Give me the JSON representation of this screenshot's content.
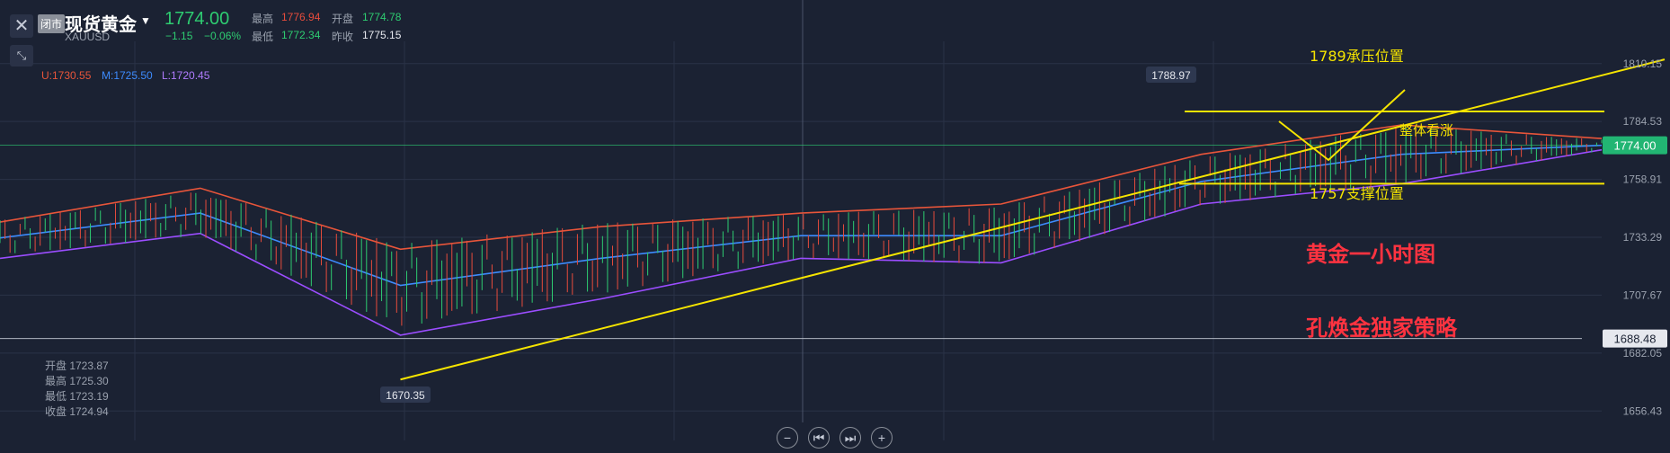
{
  "header": {
    "badge": "闭市",
    "symbol": "现货黄金",
    "code": "XAUUSD",
    "price": "1774.00",
    "change": "−1.15",
    "change_pct": "−0.06%",
    "high_label": "最高",
    "high": "1776.94",
    "open_label": "开盘",
    "open": "1774.78",
    "low_label": "最低",
    "low": "1772.34",
    "prev_label": "昨收",
    "prev_close": "1775.15"
  },
  "indicators": {
    "upper": "U:1730.55",
    "middle": "M:1725.50",
    "lower": "L:1720.45"
  },
  "ohlc_box": [
    "开盘 1723.87",
    "最高 1725.30",
    "最低 1723.19",
    "收盘 1724.94"
  ],
  "annotations": {
    "resistance": "1789承压位置",
    "support": "1757支撑位置",
    "bullish": "整体看涨",
    "title": "黄金一小时图",
    "author": "孔焕金独家策略",
    "peak": "1788.97",
    "trough": "1670.35"
  },
  "price_axis": [
    "1810.15",
    "1784.53",
    "1758.91",
    "1733.29",
    "1707.67",
    "1682.05",
    "1656.43"
  ],
  "current_price_tag": "1774.00",
  "alert_price_tag": "1688.48",
  "colors": {
    "up": "#2ecc71",
    "down": "#e74c3c",
    "upper_band": "#e8553a",
    "middle_band": "#3d8bfd",
    "lower_band": "#9b4dff",
    "trend": "#f5e400"
  },
  "chart_data": {
    "type": "line",
    "title": "黄金一小时图",
    "ylim": [
      1645,
      1820
    ],
    "x": [
      0,
      20,
      40,
      60,
      80,
      100,
      120,
      140,
      160
    ],
    "series": [
      {
        "name": "U",
        "values": [
          1740,
          1755,
          1728,
          1738,
          1744,
          1748,
          1770,
          1783,
          1777
        ]
      },
      {
        "name": "M",
        "values": [
          1733,
          1744,
          1712,
          1724,
          1734,
          1734,
          1758,
          1770,
          1774
        ]
      },
      {
        "name": "L",
        "values": [
          1724,
          1735,
          1690,
          1706,
          1724,
          1722,
          1748,
          1757,
          1772
        ]
      }
    ],
    "trendlines": [
      {
        "name": "support",
        "from": [
          40,
          1670.35
        ],
        "to": [
          160,
          1812
        ]
      },
      {
        "name": "resistance",
        "level": 1789
      },
      {
        "name": "support-level",
        "level": 1757
      }
    ]
  }
}
